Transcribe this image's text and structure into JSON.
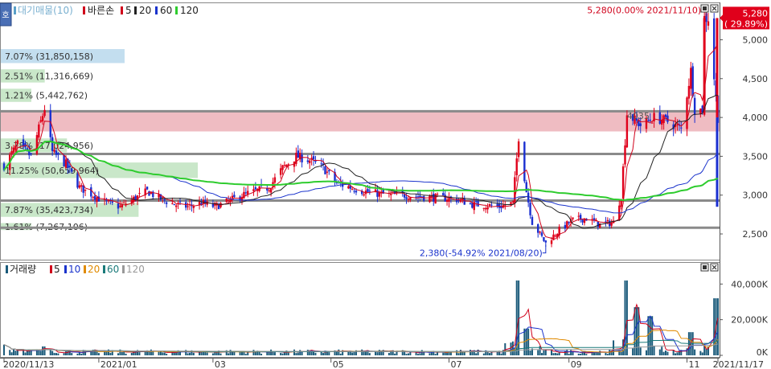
{
  "price_panel": {
    "legend": {
      "title": "대기매물(10)",
      "candle_label": "바른손",
      "ma": [
        {
          "label": "5",
          "color": "#d0021b"
        },
        {
          "label": "20",
          "color": "#222222"
        },
        {
          "label": "60",
          "color": "#1a33cc"
        },
        {
          "label": "120",
          "color": "#2ecc2e"
        }
      ]
    },
    "side_button_label": "호"
  },
  "volume_panel": {
    "legend": {
      "title": "거래량",
      "ma": [
        {
          "label": "5",
          "color": "#d0021b"
        },
        {
          "label": "10",
          "color": "#1a33cc"
        },
        {
          "label": "20",
          "color": "#e08a00"
        },
        {
          "label": "60",
          "color": "#1a7a7a"
        },
        {
          "label": "120",
          "color": "#999999"
        }
      ]
    }
  },
  "chart_data": [
    {
      "type": "candlestick",
      "ylim": [
        2200,
        5450
      ],
      "y_ticks": [
        2500,
        3000,
        3500,
        4000,
        4500,
        5000
      ],
      "y_tick_labels": [
        "2,500",
        "3,000",
        "3,500",
        "4,000",
        "4,500",
        "5,000"
      ],
      "x_range": [
        "2020-11-13",
        "2021-11-17"
      ],
      "x_axis_labels": [
        "2020/11/13",
        "2021/01",
        "03",
        "05",
        "07",
        "09",
        "11",
        "2021/11/17"
      ],
      "x_axis_label_dates": [
        "2020-11-13",
        "2021-01-01",
        "2021-03-01",
        "2021-05-01",
        "2021-07-01",
        "2021-09-01",
        "2021-11-01",
        "2021-11-17"
      ],
      "current_price_label": [
        "5,280",
        "( 29.89%)"
      ],
      "current_price": 5280,
      "annotations": [
        {
          "text": "5,280(0.00% 2021/11/10)",
          "date": "2021-11-10",
          "value": 5280,
          "color": "#d0021b"
        },
        {
          "text": "2,380(-54.92% 2021/08/20)",
          "date": "2021-08-20",
          "value": 2380,
          "color": "#1a33cc"
        }
      ],
      "horizontal_lines": [
        4080,
        3530,
        2930,
        2580
      ],
      "resistance_band": [
        3820,
        4080
      ],
      "supply_bars": [
        {
          "label": "7.07% (31,850,158)",
          "low": 4700,
          "high": 4880,
          "pct": 7.07
        },
        {
          "label": "2.51% (11,316,669)",
          "low": 4450,
          "high": 4620,
          "pct": 2.51
        },
        {
          "label": "1.21% (5,442,762)",
          "low": 4200,
          "high": 4370,
          "pct": 1.21
        },
        {
          "label": "3.78% (17,024,956)",
          "low": 3550,
          "high": 3730,
          "pct": 3.78
        },
        {
          "label": "11.25% (50,659,964)",
          "low": 3220,
          "high": 3420,
          "pct": 11.25
        },
        {
          "label": "7.87% (35,423,734)",
          "low": 2720,
          "high": 2900,
          "pct": 7.87
        },
        {
          "label": "1.61% (7,267,106)",
          "low": 2550,
          "high": 2640,
          "pct": 1.61
        }
      ],
      "overlay_labels": [
        {
          "text": "4035",
          "date": "2021-10-01",
          "value": 3980
        }
      ],
      "price_path": [
        [
          "2020-11-13",
          3380
        ],
        [
          "2020-11-20",
          3650
        ],
        [
          "2020-11-27",
          3500
        ],
        [
          "2020-12-04",
          4120
        ],
        [
          "2020-12-08",
          3550
        ],
        [
          "2020-12-15",
          3400
        ],
        [
          "2020-12-22",
          3100
        ],
        [
          "2020-12-29",
          3000
        ],
        [
          "2021-01-05",
          2900
        ],
        [
          "2021-01-12",
          2850
        ],
        [
          "2021-01-19",
          2950
        ],
        [
          "2021-01-26",
          3050
        ],
        [
          "2021-02-02",
          2950
        ],
        [
          "2021-02-09",
          2880
        ],
        [
          "2021-02-16",
          2850
        ],
        [
          "2021-02-23",
          2900
        ],
        [
          "2021-03-02",
          2850
        ],
        [
          "2021-03-09",
          2920
        ],
        [
          "2021-03-16",
          3000
        ],
        [
          "2021-03-23",
          3050
        ],
        [
          "2021-03-30",
          3100
        ],
        [
          "2021-04-06",
          3350
        ],
        [
          "2021-04-13",
          3500
        ],
        [
          "2021-04-20",
          3450
        ],
        [
          "2021-04-27",
          3350
        ],
        [
          "2021-05-04",
          3150
        ],
        [
          "2021-05-11",
          3100
        ],
        [
          "2021-05-18",
          3050
        ],
        [
          "2021-05-25",
          3020
        ],
        [
          "2021-06-01",
          3000
        ],
        [
          "2021-06-08",
          3000
        ],
        [
          "2021-06-15",
          2980
        ],
        [
          "2021-06-22",
          2970
        ],
        [
          "2021-06-29",
          2960
        ],
        [
          "2021-07-06",
          2940
        ],
        [
          "2021-07-13",
          2880
        ],
        [
          "2021-07-20",
          2870
        ],
        [
          "2021-07-27",
          2850
        ],
        [
          "2021-08-03",
          2900
        ],
        [
          "2021-08-06",
          3750
        ],
        [
          "2021-08-10",
          3050
        ],
        [
          "2021-08-13",
          2650
        ],
        [
          "2021-08-20",
          2380
        ],
        [
          "2021-08-27",
          2550
        ],
        [
          "2021-09-03",
          2680
        ],
        [
          "2021-09-10",
          2700
        ],
        [
          "2021-09-17",
          2620
        ],
        [
          "2021-09-24",
          2650
        ],
        [
          "2021-09-28",
          3000
        ],
        [
          "2021-10-01",
          4050
        ],
        [
          "2021-10-08",
          3900
        ],
        [
          "2021-10-15",
          4000
        ],
        [
          "2021-10-22",
          3950
        ],
        [
          "2021-10-29",
          3850
        ],
        [
          "2021-11-03",
          4600
        ],
        [
          "2021-11-05",
          4100
        ],
        [
          "2021-11-09",
          4100
        ],
        [
          "2021-11-10",
          5280
        ],
        [
          "2021-11-12",
          5280
        ],
        [
          "2021-11-17",
          4000
        ]
      ]
    },
    {
      "type": "bar",
      "title": "거래량",
      "ylim": [
        0,
        46000
      ],
      "y_ticks": [
        0,
        20000,
        40000
      ],
      "y_tick_labels": [
        "0K",
        "20,000K",
        "40,000K"
      ],
      "spikes": [
        {
          "date": "2020-11-13",
          "value": 6000
        },
        {
          "date": "2020-12-04",
          "value": 5000
        },
        {
          "date": "2021-08-06",
          "value": 42000
        },
        {
          "date": "2021-08-10",
          "value": 15000
        },
        {
          "date": "2021-10-01",
          "value": 42000
        },
        {
          "date": "2021-10-06",
          "value": 27000
        },
        {
          "date": "2021-10-13",
          "value": 22000
        },
        {
          "date": "2021-11-03",
          "value": 13000
        },
        {
          "date": "2021-11-16",
          "value": 32000
        }
      ]
    }
  ]
}
